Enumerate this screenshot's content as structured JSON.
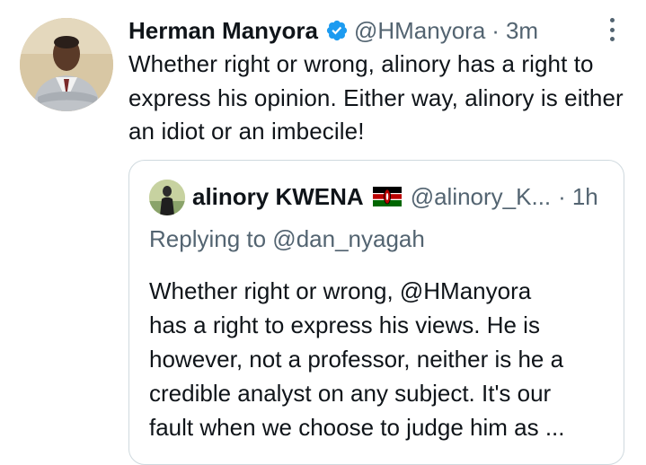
{
  "tweet": {
    "author_name": "Herman Manyora",
    "verified_icon": "verified-badge-icon",
    "handle": "@HManyora",
    "separator": "·",
    "time": "3m",
    "more_icon": "more-options-icon",
    "text": "Whether right or wrong, alinory has a right to express his opinion. Either way, alinory is either an idiot or an imbecile!"
  },
  "quoted_tweet": {
    "author_name": "alinory KWENA",
    "flag_icon": "kenya-flag-icon",
    "handle": "@alinory_K...",
    "separator": "·",
    "time": "1h",
    "replying_to": "Replying to @dan_nyagah",
    "text_lines": [
      "Whether right or wrong, @HManyora",
      "has a right to express his views. He is",
      "however, not a professor, neither is he a",
      "credible analyst on any subject. It's our",
      "fault when we choose to judge him as ..."
    ]
  },
  "colors": {
    "primary_text": "#0f1419",
    "secondary_text": "#536471",
    "verified_blue": "#1d9bf0",
    "border": "#cfd9de"
  }
}
